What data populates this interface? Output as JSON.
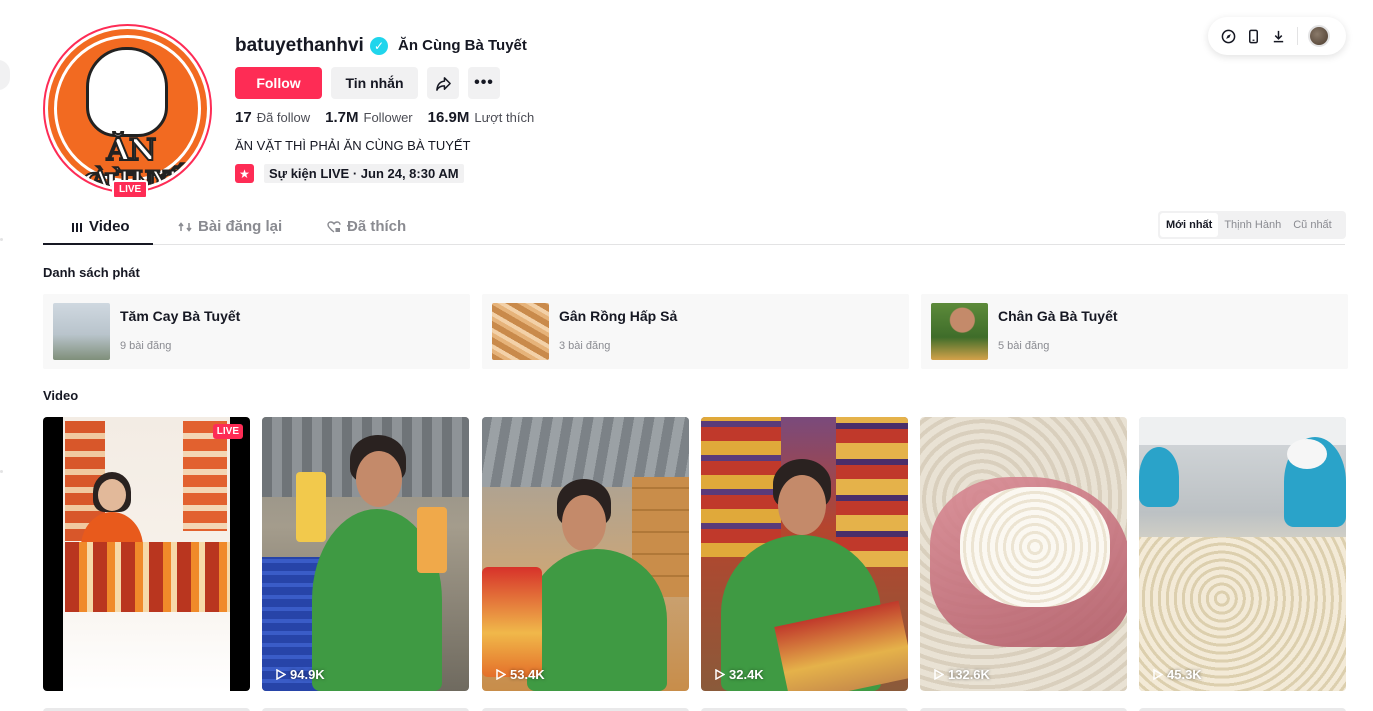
{
  "profile": {
    "username": "batuyethanhvi",
    "nickname": "Ăn Cùng Bà Tuyết",
    "avatar_brand_line1": "ĂN CÙNG",
    "avatar_brand_line2": "À TUYẾ",
    "live_badge": "LIVE",
    "follow_label": "Follow",
    "message_label": "Tin nhắn",
    "stats": {
      "following_count": "17",
      "following_label": "Đã follow",
      "followers_count": "1.7M",
      "followers_label": "Follower",
      "likes_count": "16.9M",
      "likes_label": "Lượt thích"
    },
    "bio": "ĂN VẶT THÌ PHẢI ĂN CÙNG BÀ TUYẾT",
    "event": "Sự kiện LIVE · Jun 24, 8:30 AM"
  },
  "toolbar": {
    "icons": [
      "compass-icon",
      "phone-icon",
      "download-icon",
      "user-avatar"
    ]
  },
  "tabs": {
    "video": "Video",
    "reposts": "Bài đăng lại",
    "liked": "Đã thích"
  },
  "sort": {
    "newest": "Mới nhất",
    "popular": "Thịnh Hành",
    "oldest": "Cũ nhất"
  },
  "sections": {
    "playlists_title": "Danh sách phát",
    "videos_title": "Video"
  },
  "playlists": [
    {
      "name": "Tăm Cay Bà Tuyết",
      "count": "9 bài đăng"
    },
    {
      "name": "Gân Rồng Hấp Sả",
      "count": "3 bài đăng"
    },
    {
      "name": "Chân Gà Bà Tuyết",
      "count": "5 bài đăng"
    }
  ],
  "videos": [
    {
      "live": "LIVE",
      "views": ""
    },
    {
      "views": "94.9K"
    },
    {
      "views": "53.4K"
    },
    {
      "views": "32.4K"
    },
    {
      "views": "132.6K"
    },
    {
      "views": "45.3K"
    }
  ],
  "colors": {
    "accent": "#fe2c55",
    "verified": "#20d5ec",
    "avatar_bg": "#f26a21"
  }
}
